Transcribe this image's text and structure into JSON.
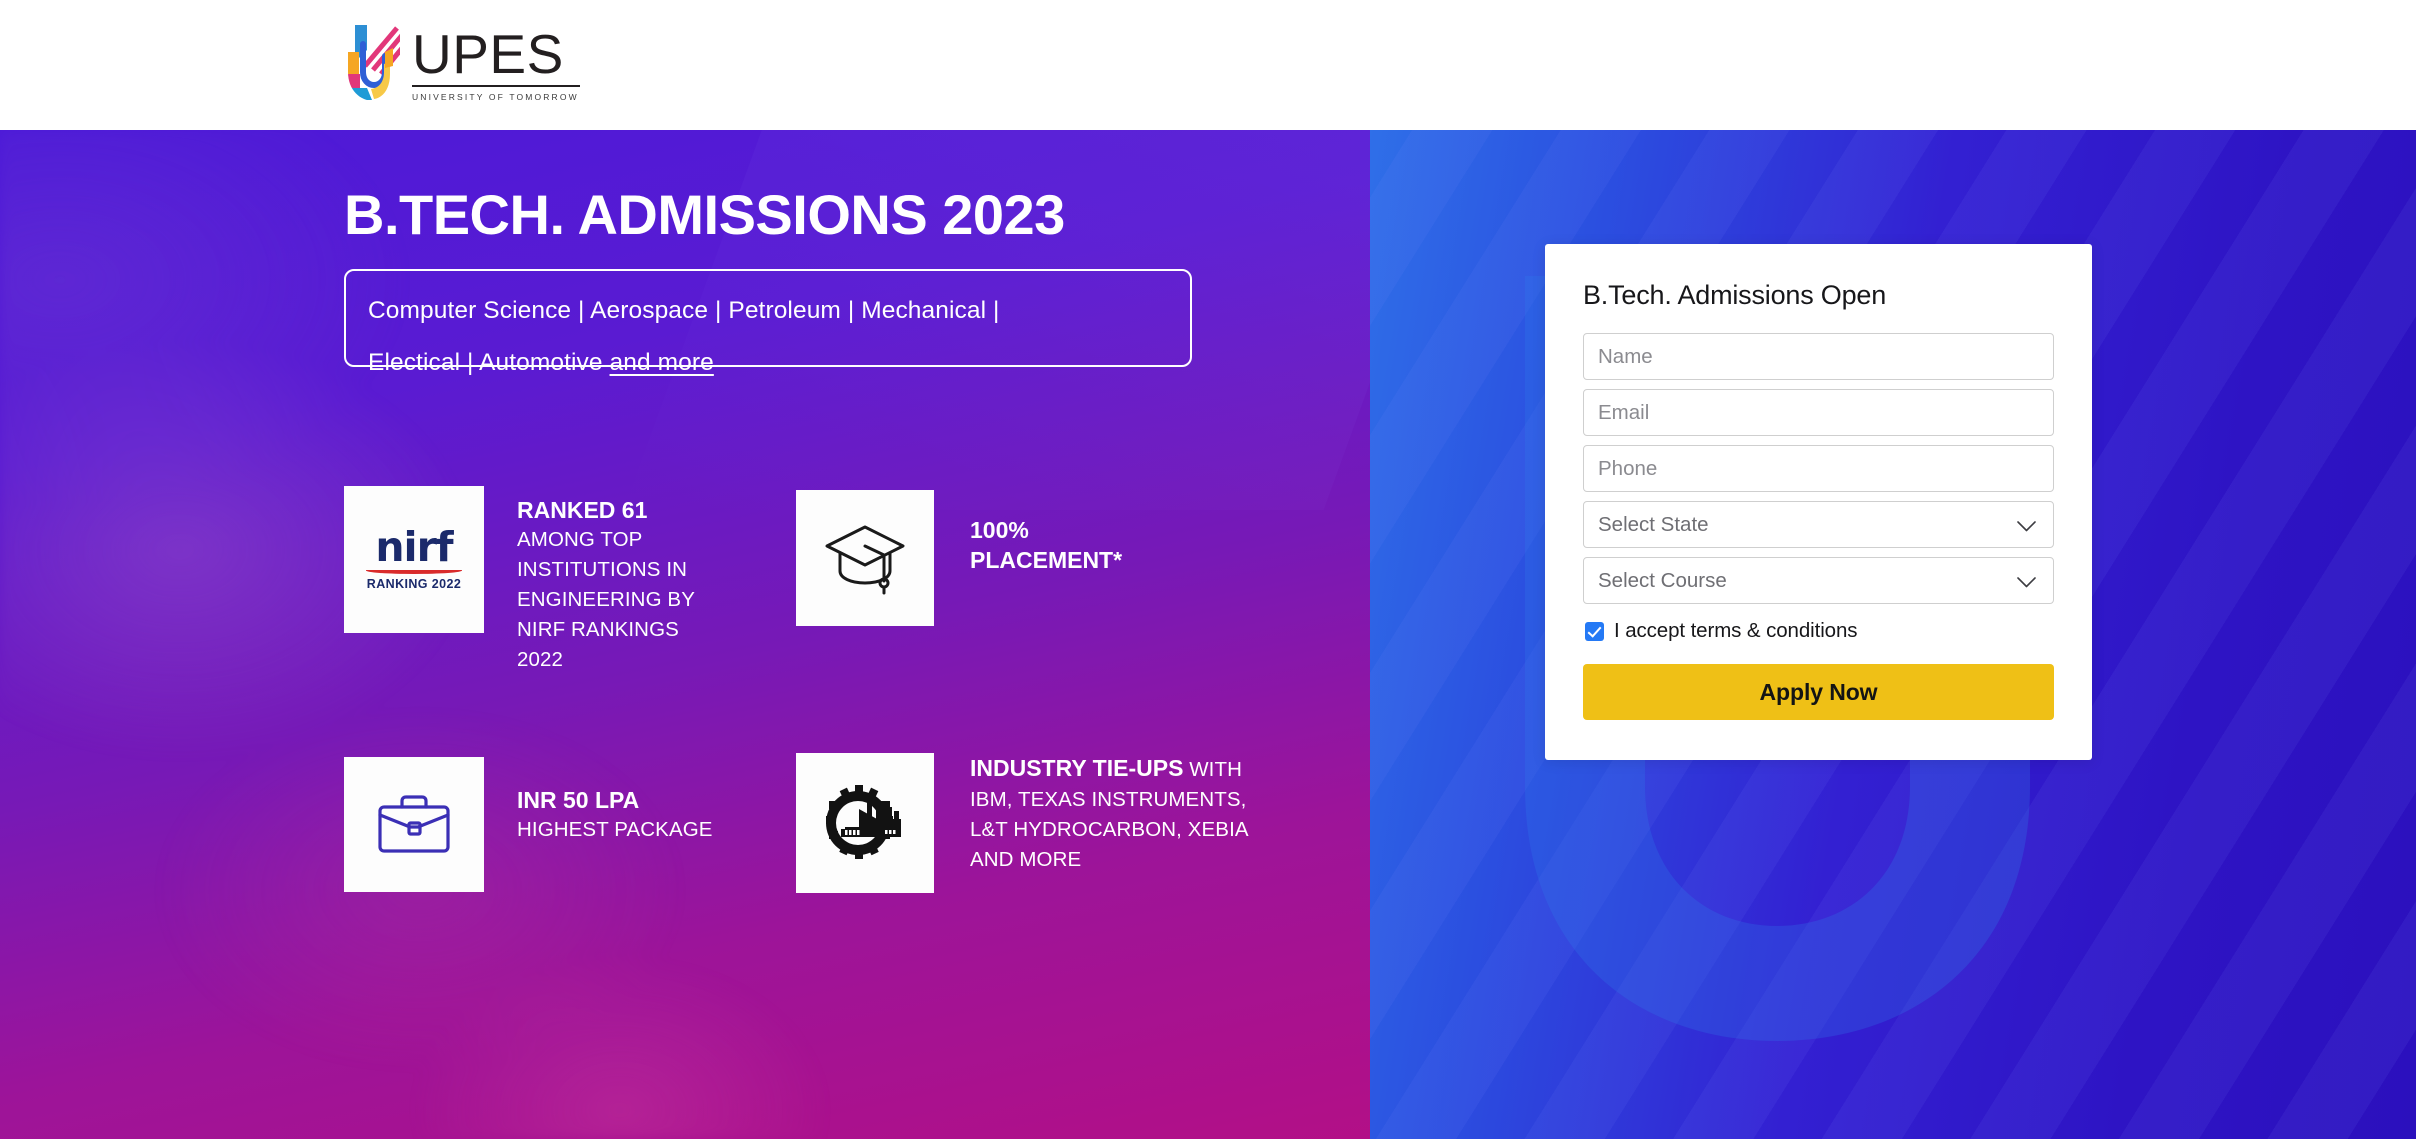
{
  "header": {
    "logo": {
      "wordmark": "UPES",
      "tagline": "UNIVERSITY OF TOMORROW",
      "shield_icon": "upes-shield-icon",
      "colors": [
        "#1f9bd6",
        "#e2377a",
        "#f5a623",
        "#f7c948",
        "#2d8fd4"
      ]
    }
  },
  "hero": {
    "headline": "B.TECH. ADMISSIONS 2023",
    "course_box": {
      "line1": "Computer Science | Aerospace | Petroleum | Mechanical |",
      "line2_prefix": "Electical | Automotive ",
      "line2_link": "and more"
    },
    "stats": [
      {
        "id": "ranked",
        "icon": "nirf-ranking-logo",
        "nirf_word": "nirf",
        "nirf_year": "RANKING 2022",
        "title": "RANKED 61",
        "sub": "AMONG TOP INSTITUTIONS IN ENGINEERING BY NIRF RANKINGS 2022"
      },
      {
        "id": "placement",
        "icon": "graduation-cap-icon",
        "title": "100%",
        "sub": "PLACEMENT*"
      },
      {
        "id": "package",
        "icon": "briefcase-icon",
        "title": "INR 50 LPA",
        "sub": "HIGHEST PACKAGE"
      },
      {
        "id": "tieups",
        "icon": "factory-gear-icon",
        "title": "INDUSTRY TIE-UPS",
        "sub": " WITH IBM, TEXAS INSTRUMENTS, L&T HYDROCARBON, XEBIA AND MORE"
      }
    ]
  },
  "form": {
    "title": "B.Tech. Admissions Open",
    "fields": [
      {
        "name": "name",
        "placeholder": "Name",
        "value": "",
        "type": "text"
      },
      {
        "name": "email",
        "placeholder": "Email",
        "value": "",
        "type": "text"
      },
      {
        "name": "phone",
        "placeholder": "Phone",
        "value": "",
        "type": "text"
      }
    ],
    "selects": [
      {
        "name": "state",
        "value": "Select State",
        "icon": "chevron-down-icon"
      },
      {
        "name": "course",
        "value": "Select Course",
        "icon": "chevron-down-icon"
      }
    ],
    "terms": {
      "label": "I accept terms & conditions",
      "checked": true
    },
    "submit_label": "Apply Now"
  },
  "colors": {
    "accent_yellow": "#efc016",
    "checkbox_blue": "#2479f5",
    "bg_indigo": "#4c1ad8",
    "bg_magenta": "#b30f86",
    "bg_blue": "#2e14c4",
    "nirf_navy": "#1b2a6b",
    "nirf_red": "#d92b2b"
  }
}
